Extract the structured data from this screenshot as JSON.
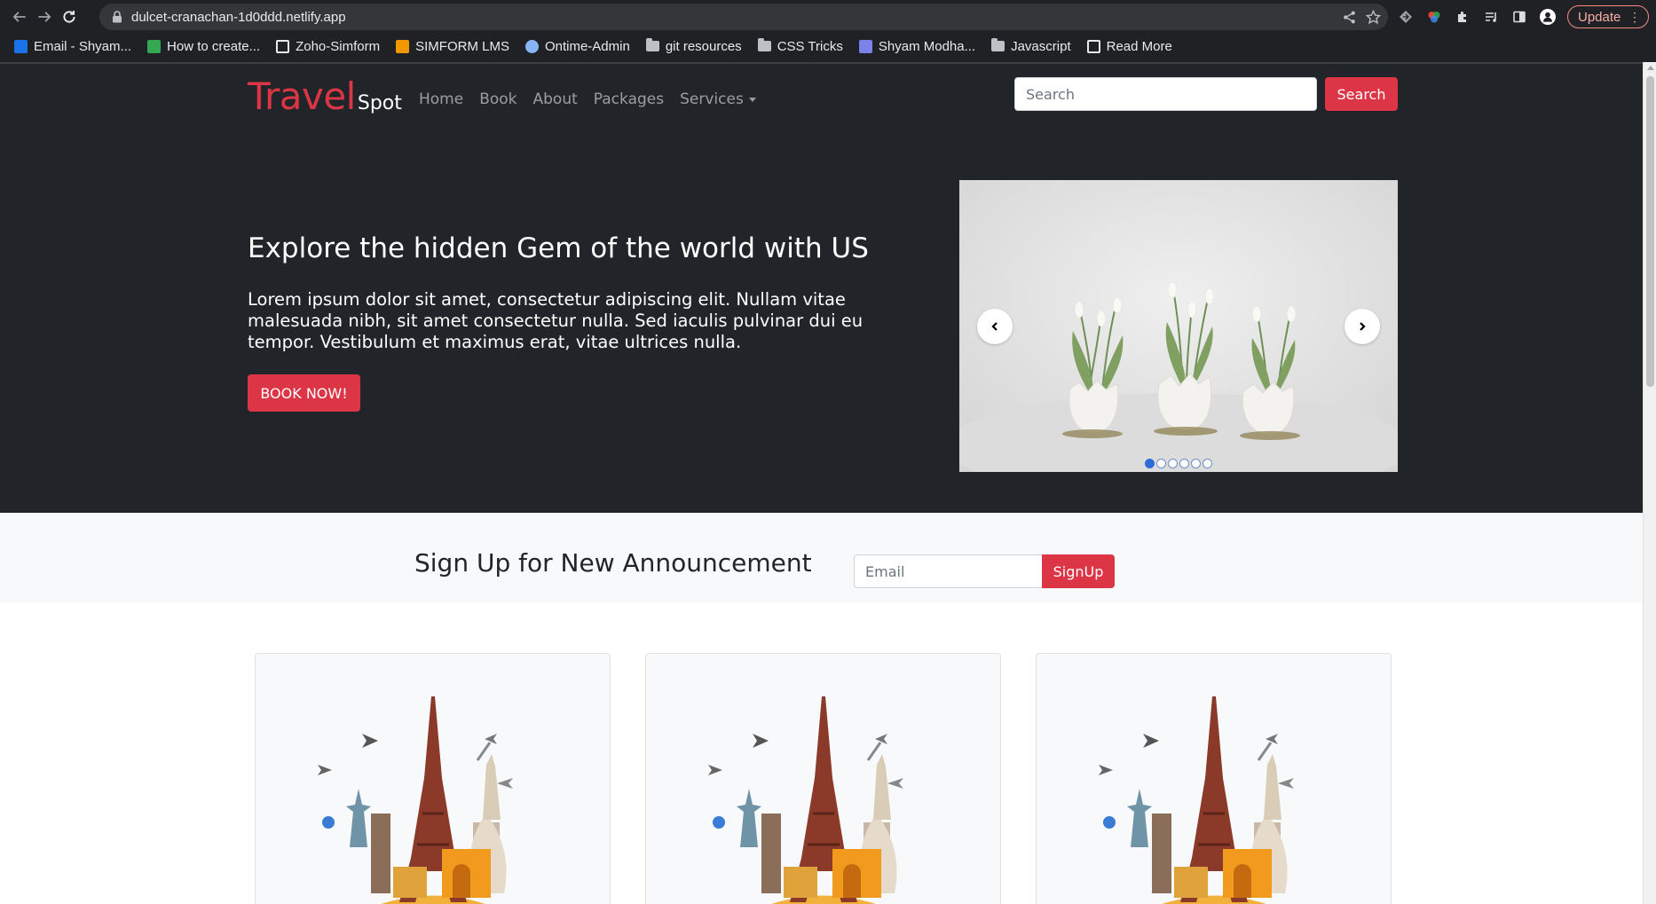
{
  "browser": {
    "url": "dulcet-cranachan-1d0ddd.netlify.app",
    "update_label": "Update",
    "bookmarks": [
      {
        "label": "Email - Shyam...",
        "icon": "outlook-icon",
        "color": "#1a73e8"
      },
      {
        "label": "How to create...",
        "icon": "link-icon",
        "color": "#34a853"
      },
      {
        "label": "Zoho-Simform",
        "icon": "zoho-icon",
        "color": "#ffffff"
      },
      {
        "label": "SIMFORM LMS",
        "icon": "lms-icon",
        "color": "#f29900"
      },
      {
        "label": "Ontime-Admin",
        "icon": "ontime-icon",
        "color": "#8ab4f8"
      },
      {
        "label": "git resources",
        "icon": "folder-icon",
        "color": "#bdc1c6"
      },
      {
        "label": "CSS Tricks",
        "icon": "folder-icon",
        "color": "#bdc1c6"
      },
      {
        "label": "Shyam Modha...",
        "icon": "teams-icon",
        "color": "#7b83eb"
      },
      {
        "label": "Javascript",
        "icon": "folder-icon",
        "color": "#bdc1c6"
      },
      {
        "label": "Read More",
        "icon": "readmore-icon",
        "color": "#ffffff"
      }
    ]
  },
  "header": {
    "brand_main": "Travel",
    "brand_sub": "Spot",
    "nav": [
      "Home",
      "Book",
      "About",
      "Packages",
      "Services"
    ],
    "search_placeholder": "Search",
    "search_button": "Search"
  },
  "hero": {
    "title": "Explore the hidden Gem of the world with US",
    "text": "Lorem ipsum dolor sit amet, consectetur adipiscing elit. Nullam vitae malesuada nibh, sit amet consectetur nulla. Sed iaculis pulvinar dui eu tempor. Vestibulum et maximus erat, vitae ultrices nulla.",
    "button": "BOOK NOW!",
    "carousel_active_index": 0,
    "carousel_count": 6
  },
  "signup": {
    "title": "Sign Up for New Announcement",
    "email_placeholder": "Email",
    "button": "SignUp"
  },
  "colors": {
    "brand_red": "#dc3545",
    "dark_bg": "#212529",
    "light_bg": "#f8f9fa"
  }
}
